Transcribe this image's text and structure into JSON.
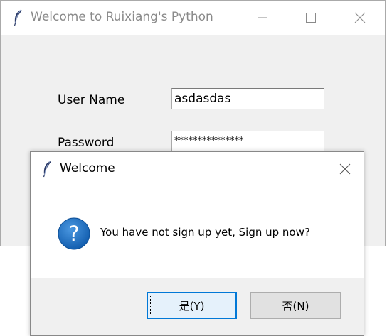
{
  "main_window": {
    "title": "Welcome to Ruixiang's Python",
    "icons": {
      "app": "feather-icon",
      "minimize": "minimize-icon",
      "maximize": "maximize-icon",
      "close": "close-icon"
    },
    "form": {
      "username_label": "User Name",
      "username_value": "asdasdas",
      "password_label": "Password",
      "password_value": "***************"
    }
  },
  "dialog": {
    "title": "Welcome",
    "icons": {
      "app": "feather-icon",
      "close": "close-icon",
      "message": "question-icon"
    },
    "message": "You have not sign up yet, Sign up now?",
    "yes_label": "是(Y)",
    "no_label": "否(N)"
  },
  "colors": {
    "accent": "#0078d7",
    "question_icon": "#1a6fc7"
  }
}
